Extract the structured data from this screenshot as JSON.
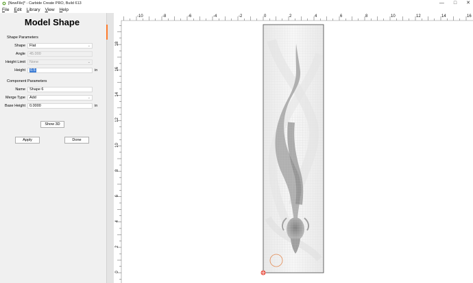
{
  "window": {
    "title": "[NewFile]* - Carbide Create PRO, Build 613",
    "controls": [
      "—",
      "□",
      "✕"
    ]
  },
  "menu": [
    "File",
    "Edit",
    "Library",
    "View",
    "Help"
  ],
  "panel": {
    "title": "Model Shape",
    "shape_params_title": "Shape Parameters",
    "shape_label": "Shape",
    "shape_value": "Flat",
    "angle_label": "Angle",
    "angle_value": "45.000",
    "height_limit_label": "Height Limit",
    "height_limit_value": "None",
    "height_label": "Height",
    "height_value": "0.5",
    "height_unit": "in",
    "component_params_title": "Component Parameters",
    "name_label": "Name",
    "name_value": "Shape 6",
    "merge_label": "Merge Type",
    "merge_value": "Add",
    "base_height_label": "Base Height",
    "base_height_value": "0.0000",
    "base_height_unit": "in",
    "show3d_label": "Show 3D",
    "apply_label": "Apply",
    "done_label": "Done"
  },
  "ruler": {
    "x_ticks": [
      "-10",
      "-8",
      "-6",
      "-4",
      "-2",
      "0",
      "2",
      "4",
      "6",
      "8",
      "10",
      "12",
      "14",
      "16"
    ],
    "y_ticks": [
      "18",
      "16",
      "14",
      "12",
      "10",
      "8",
      "6",
      "4",
      "2",
      "0"
    ]
  }
}
